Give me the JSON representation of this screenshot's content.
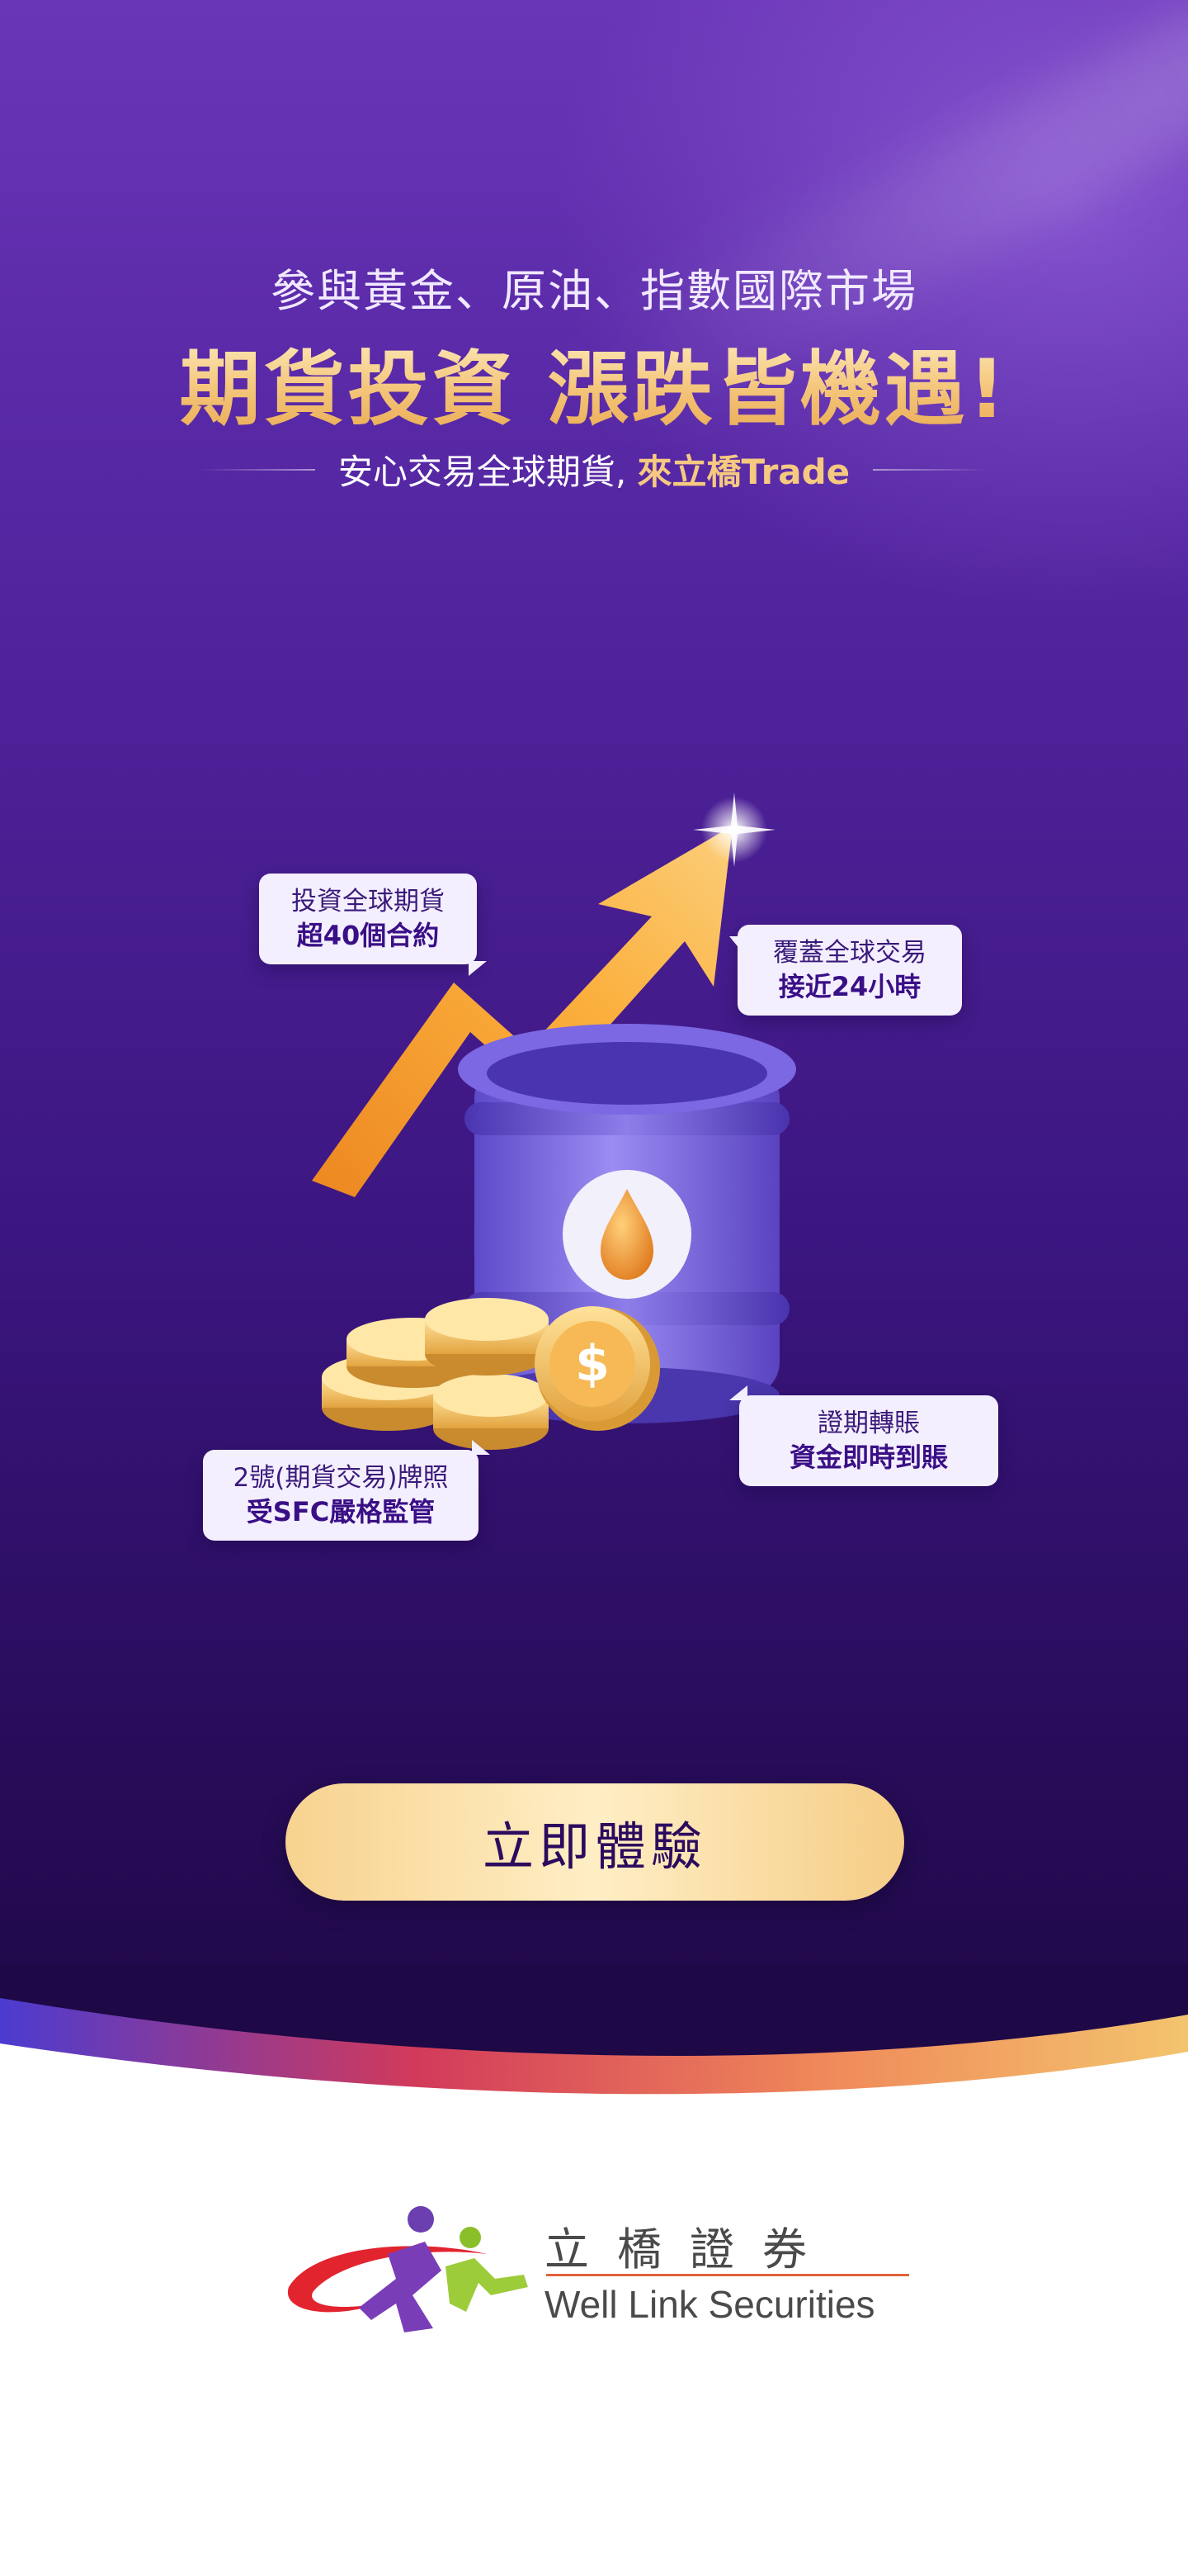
{
  "hero": {
    "subtitle": "參與黃金、原油、指數國際市場",
    "headline": "期貨投資 漲跌皆機遇!",
    "tagline_prefix": "安心交易全球期貨, ",
    "tagline_brand": "來立橋Trade"
  },
  "features": [
    {
      "line1": "投資全球期貨",
      "line2": "超40個合約"
    },
    {
      "line1": "覆蓋全球交易",
      "line2": "接近24小時"
    },
    {
      "line1": "證期轉賬",
      "line2": "資金即時到賬"
    },
    {
      "line1": "2號(期貨交易)牌照",
      "line2": "受SFC嚴格監管"
    }
  ],
  "cta": {
    "label": "立即體驗"
  },
  "footer": {
    "logo_zh": "立橋證券",
    "logo_en": "Well Link Securities"
  },
  "colors": {
    "bg_top": "#6a36b8",
    "bg_bottom": "#1e0846",
    "gold": "#f6c980",
    "cta": "#f7d38f",
    "bubble_bg": "#f4efff",
    "bubble_text": "#3a0f86"
  }
}
